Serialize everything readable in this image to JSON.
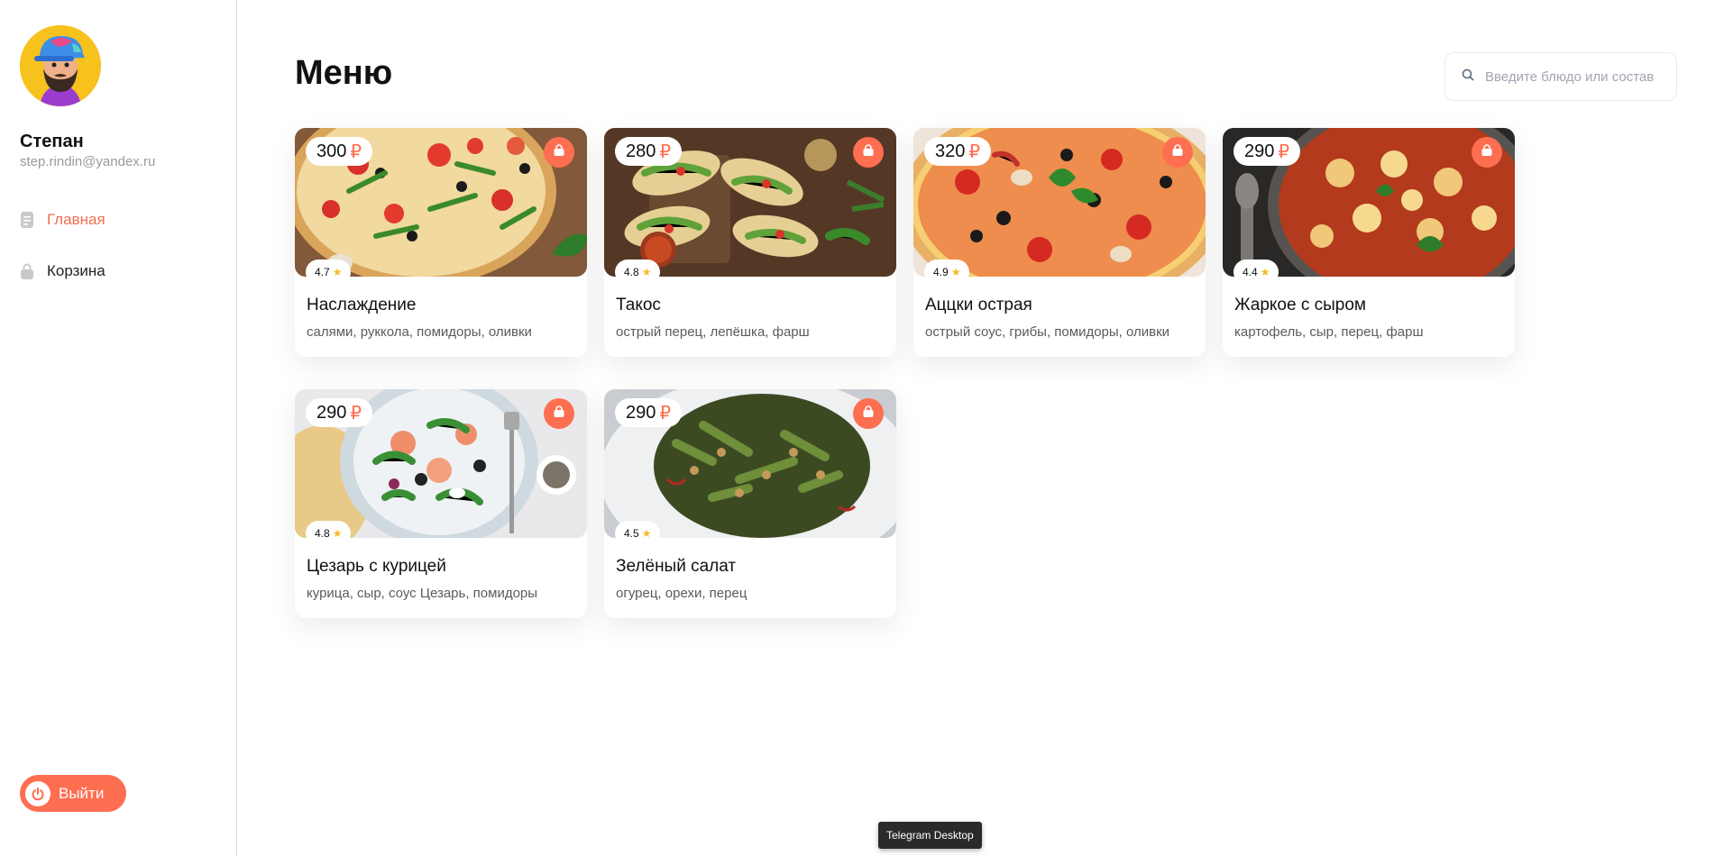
{
  "user": {
    "name": "Степан",
    "email": "step.rindin@yandex.ru"
  },
  "nav": {
    "items": [
      {
        "label": "Главная",
        "icon": "document-icon",
        "active": true
      },
      {
        "label": "Корзина",
        "icon": "lock-icon",
        "active": false
      }
    ]
  },
  "logout": {
    "label": "Выйти",
    "icon": "power-icon"
  },
  "header": {
    "title": "Меню"
  },
  "search": {
    "placeholder": "Введите блюдо или состав",
    "value": ""
  },
  "currency_symbol": "₽",
  "colors": {
    "accent": "#fe6e50",
    "star": "#f7b924"
  },
  "menu": [
    {
      "price": "300",
      "rating": "4.7",
      "title": "Наслаждение",
      "ingredients": "салями, руккола, помидоры, оливки"
    },
    {
      "price": "280",
      "rating": "4.8",
      "title": "Такос",
      "ingredients": "острый перец, лепёшка, фарш"
    },
    {
      "price": "320",
      "rating": "4.9",
      "title": "Аццки острая",
      "ingredients": "острый соус, грибы, помидоры, оливки"
    },
    {
      "price": "290",
      "rating": "4.4",
      "title": "Жаркое с сыром",
      "ingredients": "картофель, сыр, перец, фарш"
    },
    {
      "price": "290",
      "rating": "4.8",
      "title": "Цезарь с курицей",
      "ingredients": "курица, сыр, соус Цезарь, помидоры"
    },
    {
      "price": "290",
      "rating": "4.5",
      "title": "Зелёный салат",
      "ingredients": "огурец, орехи, перец"
    }
  ],
  "tooltip": {
    "text": "Telegram Desktop"
  }
}
